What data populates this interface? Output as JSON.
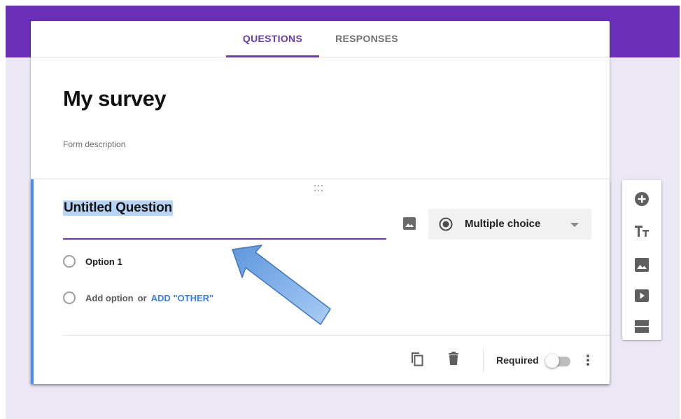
{
  "tabs": [
    {
      "label": "QUESTIONS",
      "active": true
    },
    {
      "label": "RESPONSES",
      "active": false
    }
  ],
  "form": {
    "title": "My survey",
    "description_placeholder": "Form description"
  },
  "question": {
    "title": "Untitled Question",
    "type_label": "Multiple choice",
    "options": [
      "Option 1"
    ],
    "add_option_label": "Add option",
    "or_label": "or",
    "add_other_label": "ADD \"OTHER\"",
    "required_label": "Required",
    "required": false
  },
  "side_toolbar": {
    "icons": [
      "add-question-icon",
      "title-text-icon",
      "image-icon",
      "video-icon",
      "section-icon"
    ]
  },
  "colors": {
    "header_purple": "#6a30b8",
    "accent": "#673ab7",
    "link_blue": "#3b7ee8",
    "question_accent": "#4a8ef0",
    "background": "#ebe7f5"
  }
}
